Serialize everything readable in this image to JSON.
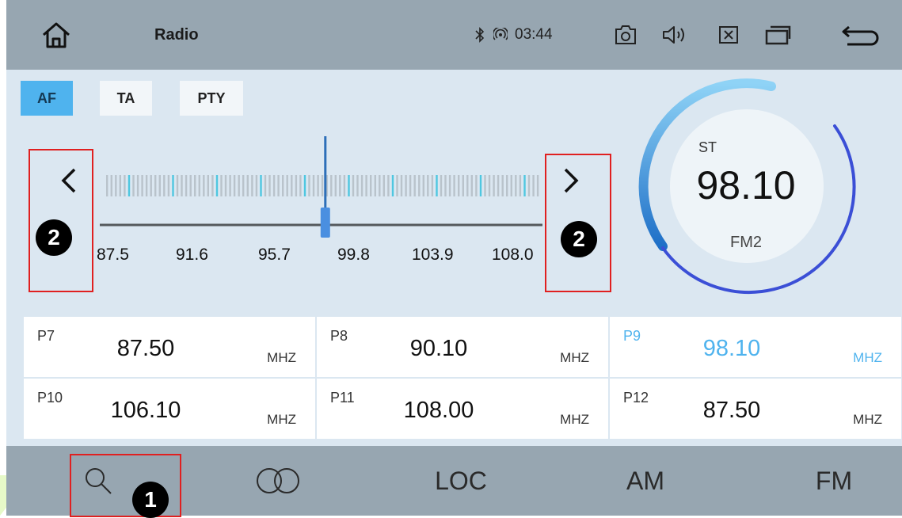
{
  "status_bar": {
    "title": "Radio",
    "time": "03:44",
    "icons": [
      "home-icon",
      "bluetooth-icon",
      "signal-icon",
      "camera-icon",
      "volume-icon",
      "close-box-icon",
      "windows-icon",
      "back-icon"
    ]
  },
  "rds_buttons": [
    {
      "label": "AF",
      "active": true
    },
    {
      "label": "TA",
      "active": false
    },
    {
      "label": "PTY",
      "active": false
    }
  ],
  "tuner": {
    "scale_labels": [
      "87.5",
      "91.6",
      "95.7",
      "99.8",
      "103.9",
      "108.0"
    ],
    "range": [
      87.5,
      108.0
    ],
    "current": 98.1
  },
  "dial": {
    "stereo": "ST",
    "frequency": "98.10",
    "band": "FM2"
  },
  "presets": [
    {
      "num": "P7",
      "freq": "87.50",
      "unit": "MHZ",
      "selected": false
    },
    {
      "num": "P8",
      "freq": "90.10",
      "unit": "MHZ",
      "selected": false
    },
    {
      "num": "P9",
      "freq": "98.10",
      "unit": "MHZ",
      "selected": true
    },
    {
      "num": "P10",
      "freq": "106.10",
      "unit": "MHZ",
      "selected": false
    },
    {
      "num": "P11",
      "freq": "108.00",
      "unit": "MHZ",
      "selected": false
    },
    {
      "num": "P12",
      "freq": "87.50",
      "unit": "MHZ",
      "selected": false
    }
  ],
  "bottom_bar": {
    "stereo_icon": "stereo-icon",
    "search_icon": "search-icon",
    "loc_label": "LOC",
    "am_label": "AM",
    "fm_label": "FM"
  },
  "annotations": {
    "badge_1": "1",
    "badge_2": "2"
  },
  "colors": {
    "accent": "#4fb3ee",
    "bar": "#97a6b1",
    "background": "#dbe7f1",
    "annotation_box": "#e02020"
  }
}
